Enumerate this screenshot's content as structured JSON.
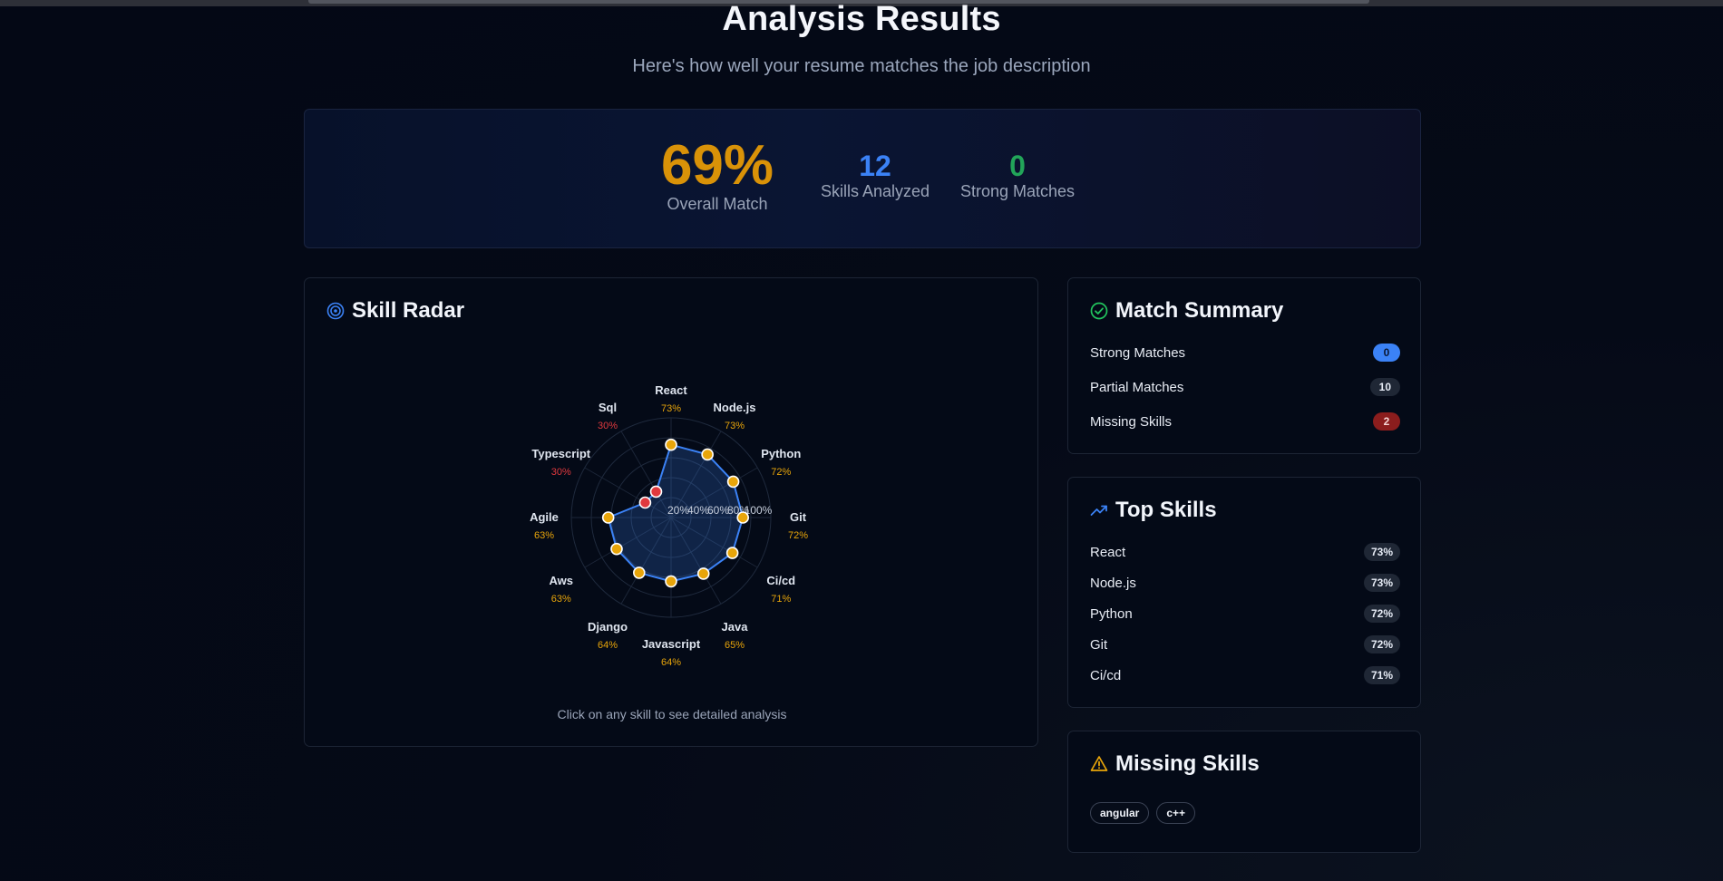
{
  "header": {
    "title": "Analysis Results",
    "subtitle": "Here's how well your resume matches the job description"
  },
  "stats": {
    "overall_value": "69%",
    "overall_label": "Overall Match",
    "skills_value": "12",
    "skills_label": "Skills Analyzed",
    "strong_value": "0",
    "strong_label": "Strong Matches"
  },
  "radar": {
    "title": "Skill Radar",
    "hint": "Click on any skill to see detailed analysis",
    "icon": "target-icon",
    "colors": {
      "good": "#e8a50a",
      "low": "#e0393e",
      "line": "#3b82f6"
    }
  },
  "chart_data": {
    "type": "radar",
    "categories": [
      "React",
      "Node.js",
      "Python",
      "Git",
      "Ci/cd",
      "Java",
      "Javascript",
      "Django",
      "Aws",
      "Agile",
      "Typescript",
      "Sql"
    ],
    "values": [
      73,
      73,
      72,
      72,
      71,
      65,
      64,
      64,
      63,
      63,
      30,
      30
    ],
    "value_labels": [
      "73%",
      "73%",
      "72%",
      "72%",
      "71%",
      "65%",
      "64%",
      "64%",
      "63%",
      "63%",
      "30%",
      "30%"
    ],
    "ring_labels": [
      "20%",
      "40%",
      "60%",
      "80%",
      "100%"
    ],
    "range": [
      0,
      100
    ]
  },
  "summary": {
    "title": "Match Summary",
    "icon": "check-circle-icon",
    "rows": [
      {
        "label": "Strong Matches",
        "value": "0"
      },
      {
        "label": "Partial Matches",
        "value": "10"
      },
      {
        "label": "Missing Skills",
        "value": "2"
      }
    ]
  },
  "top_skills": {
    "title": "Top Skills",
    "icon": "trending-up-icon",
    "rows": [
      {
        "label": "React",
        "value": "73%"
      },
      {
        "label": "Node.js",
        "value": "73%"
      },
      {
        "label": "Python",
        "value": "72%"
      },
      {
        "label": "Git",
        "value": "72%"
      },
      {
        "label": "Ci/cd",
        "value": "71%"
      }
    ]
  },
  "missing": {
    "title": "Missing Skills",
    "icon": "warning-icon",
    "chips": [
      "angular",
      "c++"
    ]
  }
}
